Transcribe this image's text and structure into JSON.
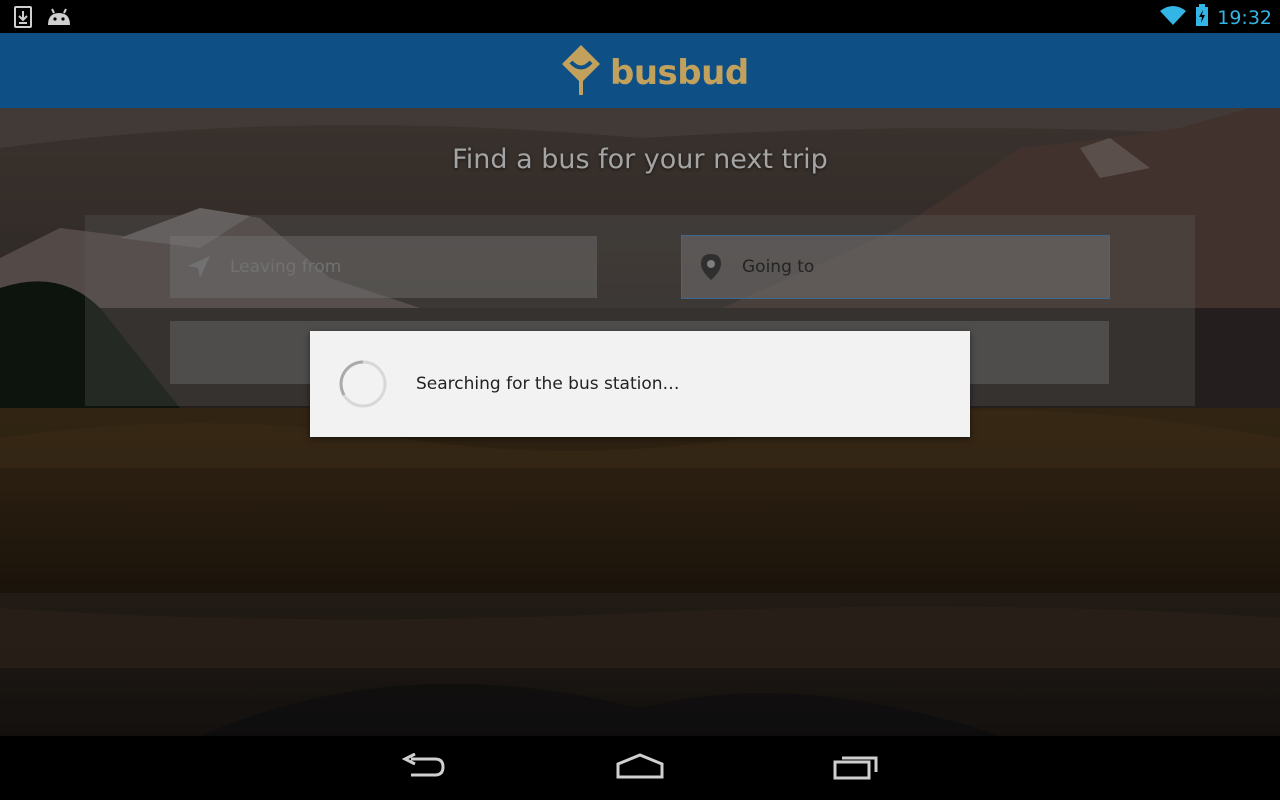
{
  "status_bar": {
    "left_icons": [
      "download-icon",
      "android-icon"
    ],
    "right_icons": [
      "wifi-icon",
      "battery-charging-icon"
    ],
    "time": "19:32"
  },
  "app": {
    "logo_text": "busbud",
    "brand_color": "#0e4f86",
    "logo_color": "#c2a15c"
  },
  "hero": {
    "headline": "Find a bus for your next trip"
  },
  "search": {
    "from_placeholder": "Leaving from",
    "to_placeholder": "Going to",
    "from_icon": "navigation-arrow-icon",
    "to_icon": "location-pin-icon"
  },
  "dialog": {
    "message": "Searching for the bus station…"
  },
  "nav_bar": {
    "buttons": [
      "back-icon",
      "home-icon",
      "recent-apps-icon"
    ]
  }
}
